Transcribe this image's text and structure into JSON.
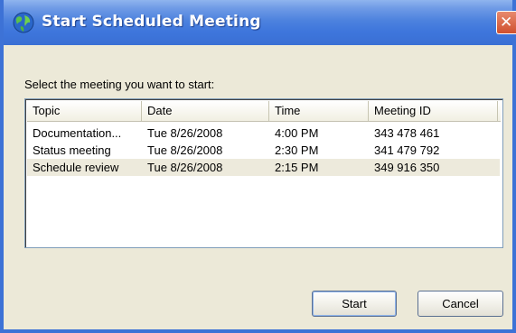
{
  "window": {
    "title": "Start Scheduled Meeting",
    "close_glyph": "✕",
    "colors": {
      "titlebar": "#3e76dc",
      "frame": "#3d72d6",
      "body": "#ece9d8",
      "close": "#d0502e",
      "selected_row": "#edeadc"
    }
  },
  "prompt": "Select the meeting you want to start:",
  "table": {
    "columns": [
      "Topic",
      "Date",
      "Time",
      "Meeting ID"
    ],
    "rows": [
      {
        "topic": "Documentation...",
        "date": "Tue 8/26/2008",
        "time": "4:00 PM",
        "meeting_id": "343 478 461",
        "selected": false
      },
      {
        "topic": "Status meeting",
        "date": "Tue 8/26/2008",
        "time": "2:30 PM",
        "meeting_id": "341 479 792",
        "selected": false
      },
      {
        "topic": "Schedule review",
        "date": "Tue 8/26/2008",
        "time": "2:15 PM",
        "meeting_id": "349 916 350",
        "selected": true
      }
    ]
  },
  "buttons": {
    "start": "Start",
    "cancel": "Cancel"
  },
  "icons": {
    "title": "globe-icon",
    "close": "close-icon"
  }
}
